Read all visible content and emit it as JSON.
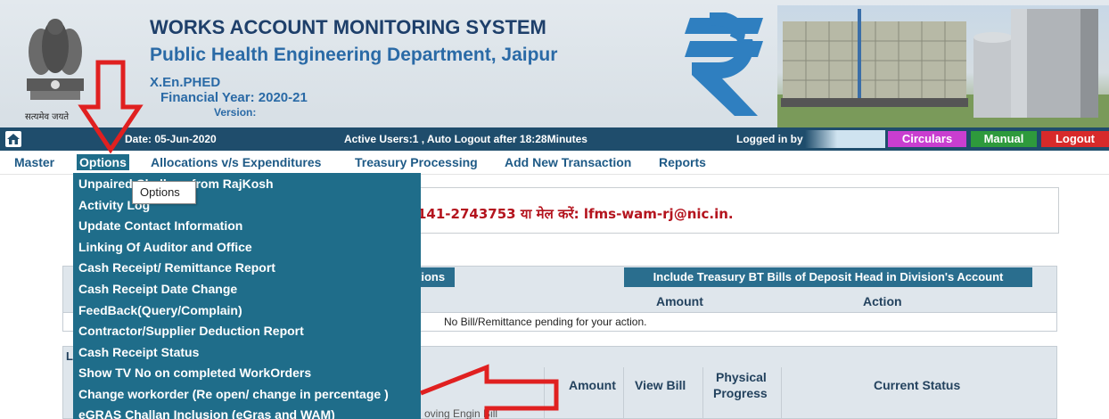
{
  "header": {
    "title": "WORKS ACCOUNT MONITORING SYSTEM",
    "department": "Public Health Engineering Department, Jaipur",
    "office": "X.En.PHED",
    "financial_year": "Financial Year: 2020-21",
    "version": "Version:",
    "emblem_caption": "सत्यमेव जयते"
  },
  "status_bar": {
    "date": "Date: 05-Jun-2020",
    "active_users": "Active Users:1 , Auto Logout after 18:28Minutes",
    "logged_in": "Logged in by",
    "circulars": "Circulars",
    "manual": "Manual",
    "logout": "Logout"
  },
  "menu": {
    "master": "Master",
    "options": "Options",
    "allocations": "Allocations v/s Expenditures",
    "treasury": "Treasury Processing",
    "add_transaction": "Add New Transaction",
    "reports": "Reports"
  },
  "dropdown": {
    "items": [
      "Unpaired Challans from RajKosh",
      "Activity Log",
      "Update Contact Information",
      "Linking Of Auditor and Office",
      "Cash Receipt/ Remittance Report",
      "Cash Receipt Date Change",
      "FeedBack(Query/Complain)",
      "Contractor/Supplier Deduction Report",
      "Cash Receipt Status",
      "Show TV No on completed WorkOrders",
      "Change workorder (Re open/ change in percentage )",
      "eGRAS Challan Inclusion (eGras and WAM)"
    ]
  },
  "tooltip": "Options",
  "notice": {
    "text": "141-2743753 या मेल करें: lfms-wam-rj@nic.in."
  },
  "panel1": {
    "options_btn": "tions",
    "include_btn": "Include Treasury BT Bills of Deposit Head in Division's Account",
    "col_amount": "Amount",
    "col_action": "Action",
    "empty_msg": "No Bill/Remittance pending for your action."
  },
  "panel2": {
    "label": "L",
    "col_amount": "Amount",
    "col_view_bill": "View Bill",
    "col_physical_progress_1": "Physical",
    "col_physical_progress_2": "Progress",
    "col_current_status": "Current Status",
    "partial_text": "oving Engin Bill"
  },
  "colors": {
    "status_bar": "#1f4d6c",
    "menu_active": "#1f6d8a",
    "circulars": "#c93ed0",
    "manual": "#2e9a3c",
    "logout": "#d72a2a",
    "annotation_arrow": "#e02020"
  }
}
